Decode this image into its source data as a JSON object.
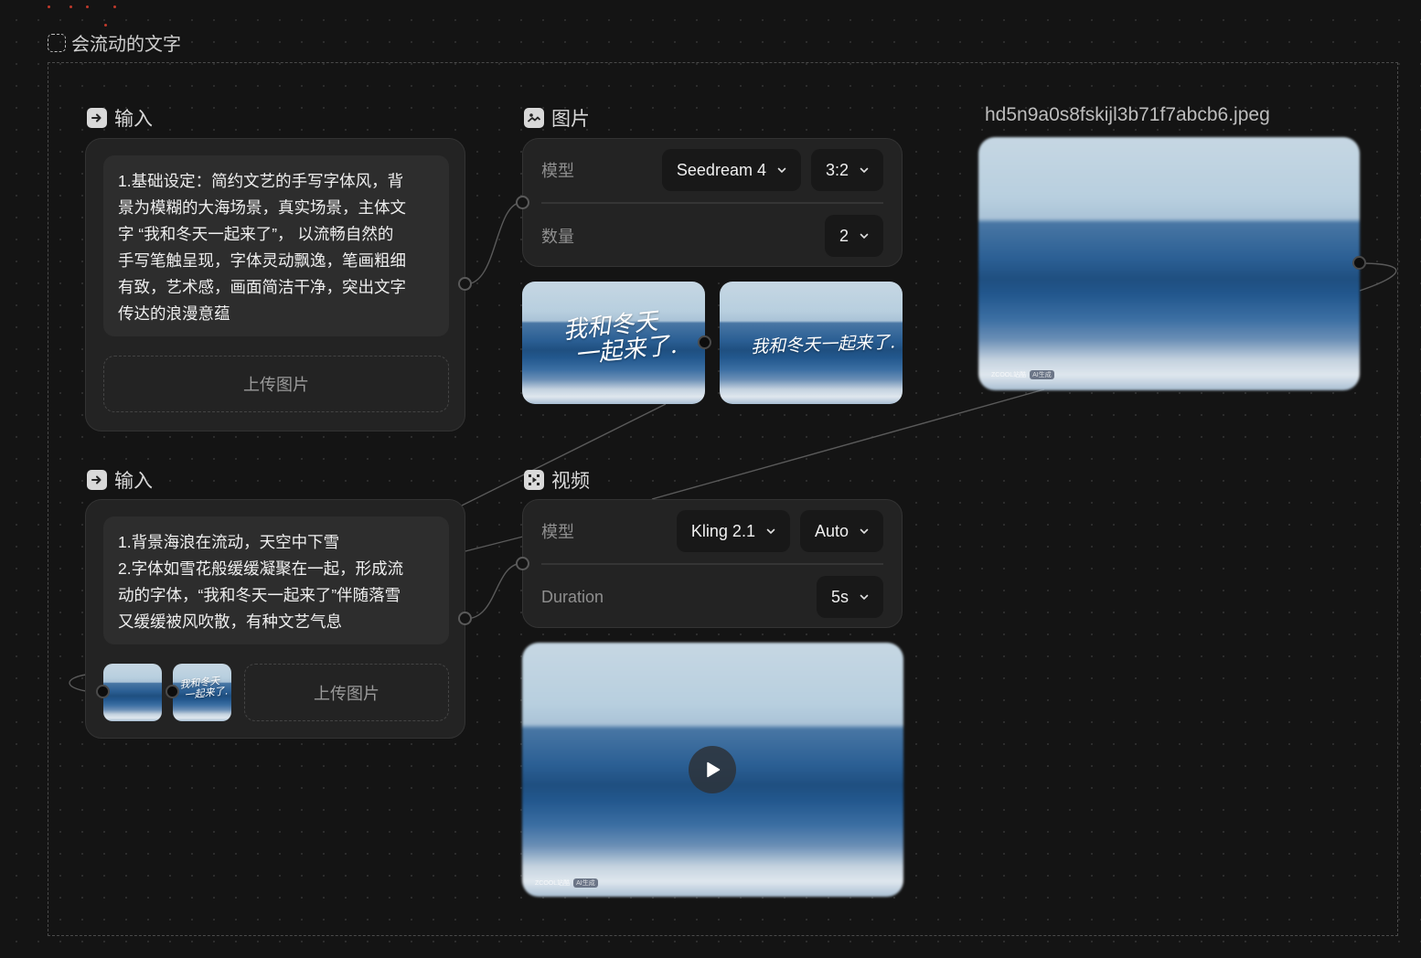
{
  "group": {
    "title": "会流动的文字"
  },
  "input1": {
    "label": "输入",
    "prompt_lines": [
      "1.基础设定：简约文艺的手写字体风，背",
      "景为模糊的大海场景，真实场景，主体文",
      "字 “我和冬天一起来了”， 以流畅自然的",
      "手写笔触呈现，字体灵动飘逸，笔画粗细",
      "有致，艺术感，画面简洁干净，突出文字",
      "传达的浪漫意蕴"
    ],
    "upload_label": "上传图片"
  },
  "input2": {
    "label": "输入",
    "prompt_lines": [
      "1.背景海浪在流动，天空中下雪",
      "2.字体如雪花般缓缓凝聚在一起，形成流",
      "动的字体，“我和冬天一起来了”伴随落雪",
      "又缓缓被风吹散，有种文艺气息"
    ],
    "upload_label": "上传图片",
    "attached_thumb_texts": [
      "我和冬天",
      "一起来了."
    ]
  },
  "image_node": {
    "label": "图片",
    "model_label": "模型",
    "model_value": "Seedream 4",
    "ratio_value": "3:2",
    "count_label": "数量",
    "count_value": "2",
    "results": [
      {
        "text_line1": "我和冬天",
        "text_line2": "一起来了."
      },
      {
        "text_line1": "我和冬天一起来了."
      }
    ]
  },
  "video_node": {
    "label": "视频",
    "model_label": "模型",
    "model_value": "Kling 2.1",
    "mode_value": "Auto",
    "duration_label": "Duration",
    "duration_value": "5s"
  },
  "output_image": {
    "filename": "hd5n9a0s8fskijl3b71f7abcb6.jpeg",
    "watermark": "ZCOOL站酷",
    "watermark_badge": "AI生成"
  },
  "video_preview": {
    "watermark": "ZCOOL站酷",
    "watermark_badge": "AI生成"
  },
  "colors": {
    "background": "#141414",
    "card": "#232323",
    "field": "#2d2d2d",
    "select": "#181818",
    "edge": "#5a5a5a"
  },
  "icons": [
    "input-arrow-icon",
    "image-icon",
    "video-icon",
    "chevron-down-icon",
    "play-icon",
    "group-dashed-square-icon"
  ]
}
